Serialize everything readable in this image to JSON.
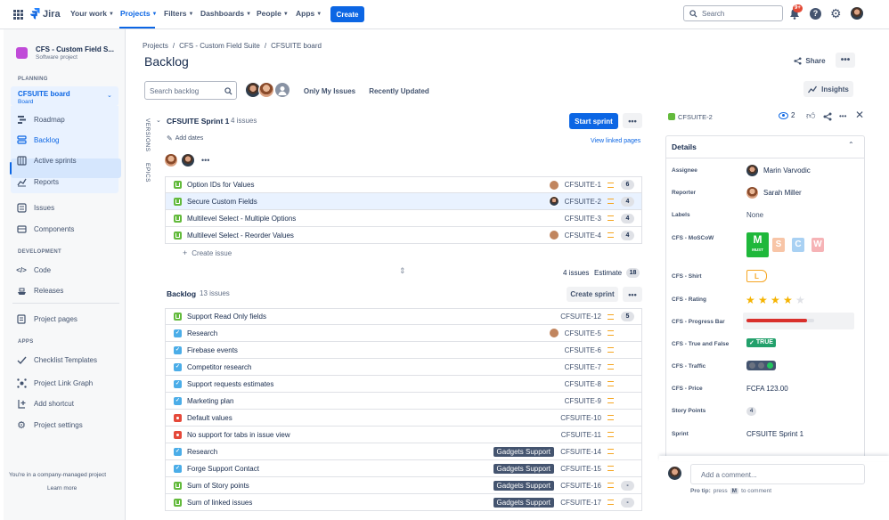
{
  "topnav": {
    "app_name": "Jira",
    "menu": [
      {
        "label": "Your work"
      },
      {
        "label": "Projects"
      },
      {
        "label": "Filters"
      },
      {
        "label": "Dashboards"
      },
      {
        "label": "People"
      },
      {
        "label": "Apps"
      }
    ],
    "create_label": "Create",
    "search_placeholder": "Search",
    "notifications_badge": "9+"
  },
  "sidebar": {
    "project_name": "CFS - Custom Field S...",
    "project_type": "Software project",
    "planning_heading": "PLANNING",
    "board_name": "CFSUITE board",
    "board_sub": "Board",
    "planning_items": [
      {
        "label": "Roadmap"
      },
      {
        "label": "Backlog"
      },
      {
        "label": "Active sprints"
      },
      {
        "label": "Reports"
      }
    ],
    "other_items": [
      {
        "label": "Issues"
      },
      {
        "label": "Components"
      }
    ],
    "development_heading": "DEVELOPMENT",
    "development_items": [
      {
        "label": "Code"
      },
      {
        "label": "Releases"
      }
    ],
    "project_pages_label": "Project pages",
    "apps_heading": "APPS",
    "apps_items": [
      {
        "label": "Checklist Templates"
      },
      {
        "label": "Project Link Graph"
      },
      {
        "label": "Add shortcut"
      },
      {
        "label": "Project settings"
      }
    ],
    "footer_text": "You're in a company-managed project",
    "learn_more": "Learn more"
  },
  "main": {
    "breadcrumb": [
      "Projects",
      "CFS - Custom Field Suite",
      "CFSUITE board"
    ],
    "breadcrumb_sep": "/",
    "title": "Backlog",
    "share_label": "Share",
    "search_placeholder": "Search backlog",
    "only_my_issues": "Only My Issues",
    "recently_updated": "Recently Updated",
    "insights_label": "Insights",
    "versions_label": "VERSIONS",
    "epics_label": "EPICS",
    "sprint": {
      "name": "CFSUITE Sprint 1",
      "count": "4 issues",
      "add_dates": "Add dates",
      "start_sprint": "Start sprint",
      "view_linked": "View linked pages",
      "create_issue": "Create issue",
      "footer_count": "4 issues",
      "footer_estimate_label": "Estimate",
      "footer_estimate": "18",
      "issues": [
        {
          "summary": "Option IDs for Values",
          "key": "CFSUITE-1",
          "type": "story",
          "estimate": "6",
          "assignee": "f"
        },
        {
          "summary": "Secure Custom Fields",
          "key": "CFSUITE-2",
          "type": "story",
          "estimate": "4",
          "assignee": "m"
        },
        {
          "summary": "Multilevel Select - Multiple Options",
          "key": "CFSUITE-3",
          "type": "story",
          "estimate": "4",
          "assignee": ""
        },
        {
          "summary": "Multilevel Select - Reorder Values",
          "key": "CFSUITE-4",
          "type": "story",
          "estimate": "4",
          "assignee": "f"
        }
      ]
    },
    "backlog": {
      "name": "Backlog",
      "count": "13 issues",
      "create_sprint": "Create sprint",
      "issues": [
        {
          "summary": "Support Read Only fields",
          "key": "CFSUITE-12",
          "type": "story",
          "estimate": "5",
          "label": "",
          "assignee": ""
        },
        {
          "summary": "Research",
          "key": "CFSUITE-5",
          "type": "task",
          "estimate": "",
          "label": "",
          "assignee": "f"
        },
        {
          "summary": "Firebase events",
          "key": "CFSUITE-6",
          "type": "task",
          "estimate": "",
          "label": "",
          "assignee": ""
        },
        {
          "summary": "Competitor research",
          "key": "CFSUITE-7",
          "type": "task",
          "estimate": "",
          "label": "",
          "assignee": ""
        },
        {
          "summary": "Support requests estimates",
          "key": "CFSUITE-8",
          "type": "task",
          "estimate": "",
          "label": "",
          "assignee": ""
        },
        {
          "summary": "Marketing plan",
          "key": "CFSUITE-9",
          "type": "task",
          "estimate": "",
          "label": "",
          "assignee": ""
        },
        {
          "summary": "Default values",
          "key": "CFSUITE-10",
          "type": "bug",
          "estimate": "",
          "label": "",
          "assignee": ""
        },
        {
          "summary": "No support for tabs in issue view",
          "key": "CFSUITE-11",
          "type": "bug",
          "estimate": "",
          "label": "",
          "assignee": ""
        },
        {
          "summary": "Research",
          "key": "CFSUITE-14",
          "type": "task",
          "estimate": "",
          "label": "Gadgets Support",
          "assignee": ""
        },
        {
          "summary": "Forge Support Contact",
          "key": "CFSUITE-15",
          "type": "task",
          "estimate": "",
          "label": "Gadgets Support",
          "assignee": ""
        },
        {
          "summary": "Sum of Story points",
          "key": "CFSUITE-16",
          "type": "story",
          "estimate": "-",
          "label": "Gadgets Support",
          "assignee": ""
        },
        {
          "summary": "Sum of linked issues",
          "key": "CFSUITE-17",
          "type": "story",
          "estimate": "-",
          "label": "Gadgets Support",
          "assignee": ""
        }
      ]
    }
  },
  "detail": {
    "issue_key": "CFSUITE-2",
    "watchers": "2",
    "details_heading": "Details",
    "fields": {
      "assignee_label": "Assignee",
      "assignee": "Marin Varvodic",
      "reporter_label": "Reporter",
      "reporter": "Sarah Miller",
      "labels_label": "Labels",
      "labels": "None",
      "moscow_label": "CFS - MoSCoW",
      "moscow_letters": [
        "M",
        "S",
        "C",
        "W"
      ],
      "moscow_selected_caption": "MUST",
      "shirt_label": "CFS - Shirt",
      "shirt": "L",
      "rating_label": "CFS - Rating",
      "rating_value": 4,
      "rating_max": 5,
      "progress_label": "CFS - Progress Bar",
      "progress_fraction": 0.9,
      "truefalse_label": "CFS - True and False",
      "truefalse": "TRUE",
      "traffic_label": "CFS - Traffic",
      "price_label": "CFS - Price",
      "price": "FCFA 123.00",
      "story_points_label": "Story Points",
      "story_points": "4",
      "sprint_label": "Sprint",
      "sprint": "CFSUITE Sprint 1"
    },
    "comment_placeholder": "Add a comment...",
    "pro_tip_prefix": "Pro tip:",
    "pro_tip_press": "press",
    "pro_tip_key": "M",
    "pro_tip_suffix": "to comment"
  },
  "colors": {
    "accent": "#0c66e4",
    "story": "#63ba3c",
    "task": "#4bade8",
    "bug": "#e5493a",
    "label_bg": "#44546f",
    "moscow_m": "#1fb83b",
    "moscow_s": "#f8c5a7",
    "moscow_c": "#a9d1f3",
    "moscow_w": "#f6b3b6",
    "progress": "#d9302c"
  }
}
